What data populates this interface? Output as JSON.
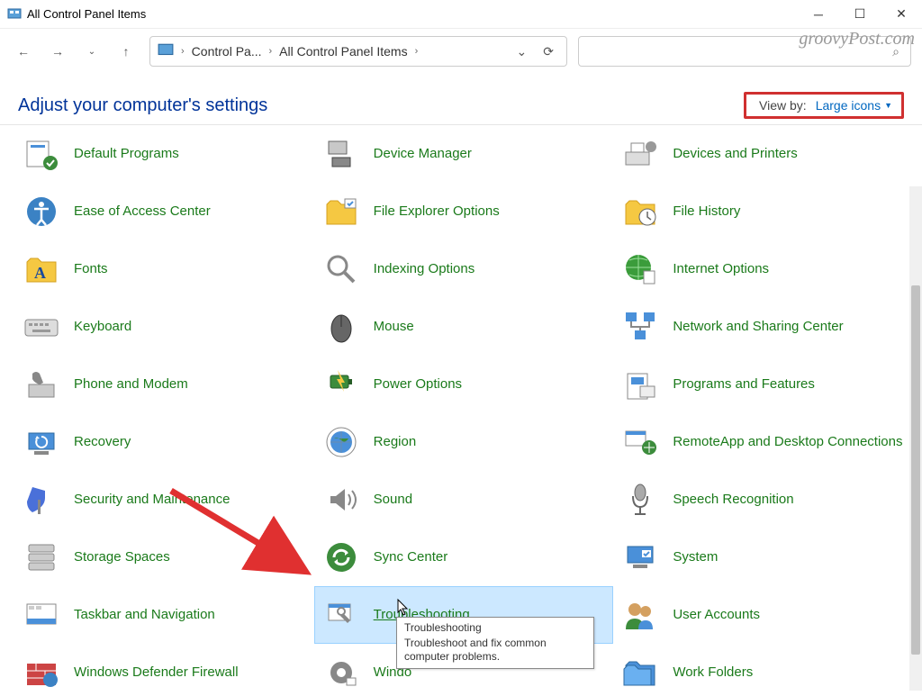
{
  "window": {
    "title": "All Control Panel Items"
  },
  "breadcrumbs": {
    "seg1": "Control Pa...",
    "seg2": "All Control Panel Items"
  },
  "header": {
    "title": "Adjust your computer's settings"
  },
  "viewby": {
    "label": "View by:",
    "value": "Large icons"
  },
  "items": {
    "r0c0": "Default Programs",
    "r0c1": "Device Manager",
    "r0c2": "Devices and Printers",
    "r1c0": "Ease of Access Center",
    "r1c1": "File Explorer Options",
    "r1c2": "File History",
    "r2c0": "Fonts",
    "r2c1": "Indexing Options",
    "r2c2": "Internet Options",
    "r3c0": "Keyboard",
    "r3c1": "Mouse",
    "r3c2": "Network and Sharing Center",
    "r4c0": "Phone and Modem",
    "r4c1": "Power Options",
    "r4c2": "Programs and Features",
    "r5c0": "Recovery",
    "r5c1": "Region",
    "r5c2": "RemoteApp and Desktop Connections",
    "r6c0": "Security and Maintenance",
    "r6c1": "Sound",
    "r6c2": "Speech Recognition",
    "r7c0": "Storage Spaces",
    "r7c1": "Sync Center",
    "r7c2": "System",
    "r8c0": "Taskbar and Navigation",
    "r8c1": "Troubleshooting",
    "r8c2": "User Accounts",
    "r9c0": "Windows Defender Firewall",
    "r9c1": "Windo",
    "r9c2": "Work Folders"
  },
  "tooltip": {
    "title": "Troubleshooting",
    "body": "Troubleshoot and fix common computer problems."
  },
  "watermark": "groovyPost.com"
}
